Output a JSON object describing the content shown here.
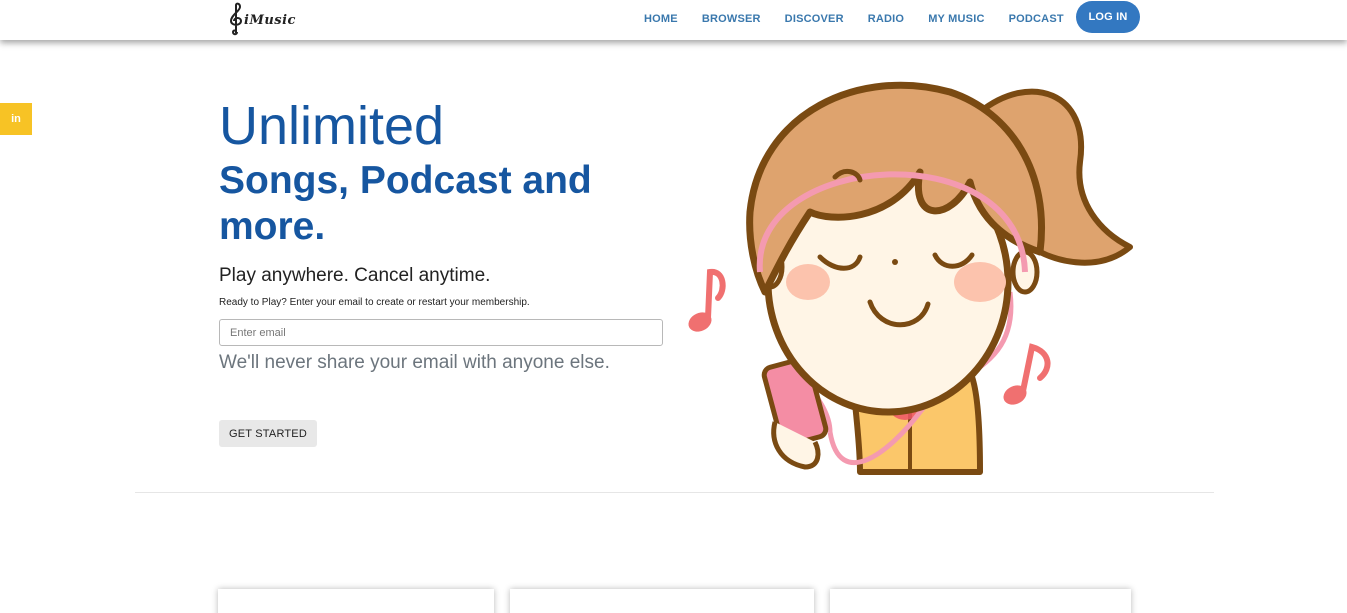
{
  "header": {
    "logo_text": "iMusic",
    "nav": [
      {
        "label": "HOME"
      },
      {
        "label": "BROWSER"
      },
      {
        "label": "DISCOVER"
      },
      {
        "label": "RADIO"
      },
      {
        "label": "MY MUSIC"
      },
      {
        "label": "PODCAST"
      }
    ],
    "login_label": "LOG IN"
  },
  "social": {
    "linkedin_label": "in"
  },
  "hero": {
    "title": "Unlimited",
    "subtitle": "Songs, Podcast and more.",
    "tagline": "Play anywhere. Cancel anytime.",
    "prompt": "Ready to Play? Enter your email to create or restart your membership.",
    "email_placeholder": "Enter email",
    "email_help": "We'll never share your email with anyone else.",
    "cta_label": "GET STARTED"
  },
  "colors": {
    "brand_blue": "#1656a0",
    "nav_link": "#3a78ad",
    "login_bg": "#3378c1",
    "linkedin_bg": "#f7c325",
    "hair": "#dea36e",
    "outline": "#7a4a12",
    "note": "#f07070"
  },
  "illustration": {
    "icon": "girl-with-headphones-illustration"
  }
}
